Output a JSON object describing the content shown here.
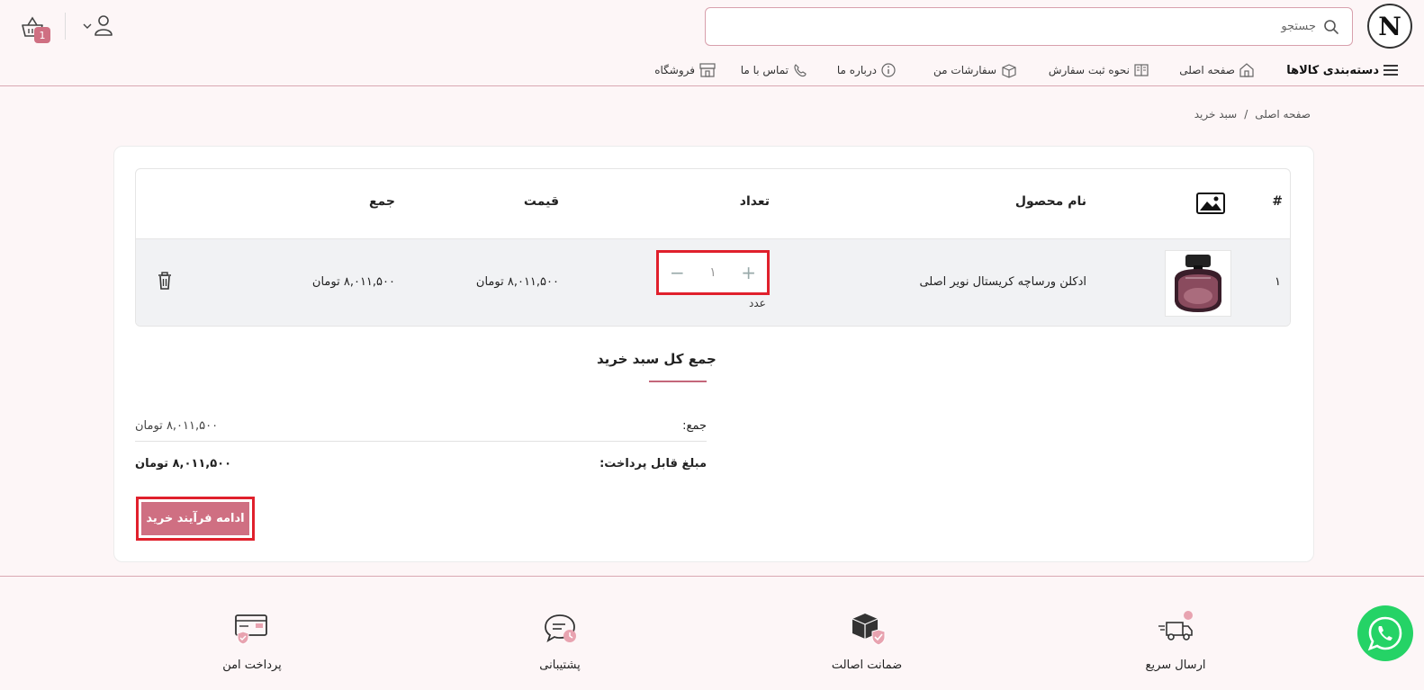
{
  "header": {
    "logo_text": "N",
    "search_placeholder": "جستجو",
    "cart_count": "1"
  },
  "nav": {
    "categories_label": "دسته‌بندی کالاها",
    "items": [
      {
        "label": "صفحه اصلی",
        "icon": "home-icon"
      },
      {
        "label": "نحوه ثبت سفارش",
        "icon": "book-icon"
      },
      {
        "label": "سفارشات من",
        "icon": "boxes-icon"
      },
      {
        "label": "درباره ما",
        "icon": "info-icon"
      },
      {
        "label": "تماس با ما",
        "icon": "phone-icon"
      },
      {
        "label": "فروشگاه",
        "icon": "store-icon"
      }
    ]
  },
  "breadcrumb": {
    "home": "صفحه اصلی",
    "separator": "/",
    "current": "سبد خرید"
  },
  "table": {
    "headers": {
      "index": "#",
      "image": "image-icon",
      "name": "نام محصول",
      "qty": "تعداد",
      "price": "قیمت",
      "total": "جمع"
    },
    "rows": [
      {
        "index": "۱",
        "name": "ادکلن ورساچه کریستال نویر اصلی",
        "qty": "۱",
        "unit": "عدد",
        "price": "۸,۰۱۱,۵۰۰ تومان",
        "total": "۸,۰۱۱,۵۰۰ تومان"
      }
    ]
  },
  "totals": {
    "title": "جمع کل سبد خرید",
    "subtotal_label": "جمع:",
    "subtotal_value": "۸,۰۱۱,۵۰۰ تومان",
    "payable_label": "مبلغ قابل پرداخت:",
    "payable_value": "۸,۰۱۱,۵۰۰ تومان",
    "checkout_label": "ادامه فرآیند خرید"
  },
  "features": [
    {
      "label": "ارسال سریع",
      "icon": "fast-delivery-icon"
    },
    {
      "label": "ضمانت اصالت",
      "icon": "authenticity-icon"
    },
    {
      "label": "پشتیبانی",
      "icon": "support-icon"
    },
    {
      "label": "پرداخت امن",
      "icon": "secure-payment-icon"
    }
  ],
  "colors": {
    "accent": "#cf6f82",
    "highlight": "#e0202c",
    "background": "#fdf6f7",
    "whatsapp": "#25d366"
  }
}
